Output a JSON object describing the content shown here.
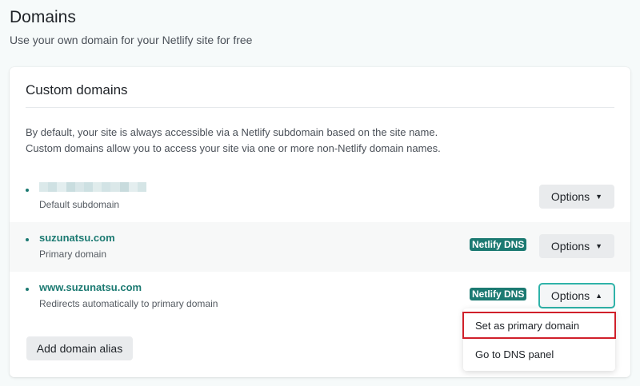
{
  "header": {
    "title": "Domains",
    "subtitle": "Use your own domain for your Netlify site for free"
  },
  "card": {
    "title": "Custom domains",
    "description": [
      "By default, your site is always accessible via a Netlify subdomain based on the site name.",
      "Custom domains allow you to access your site via one or more non-Netlify domain names."
    ],
    "domains": [
      {
        "name": "",
        "subtitle": "Default subdomain",
        "badge": null,
        "options_label": "Options",
        "chevron": "chevron-down-icon"
      },
      {
        "name": "suzunatsu.com",
        "subtitle": "Primary domain",
        "badge": "Netlify DNS",
        "options_label": "Options",
        "chevron": "chevron-down-icon"
      },
      {
        "name": "www.suzunatsu.com",
        "subtitle": "Redirects automatically to primary domain",
        "badge": "Netlify DNS",
        "options_label": "Options",
        "chevron": "chevron-up-icon"
      }
    ],
    "add_alias_label": "Add domain alias"
  },
  "dropdown": {
    "items": [
      {
        "label": "Set as primary domain",
        "selected": true
      },
      {
        "label": "Go to DNS panel",
        "selected": false
      }
    ]
  },
  "colors": {
    "accent": "#1c7a72",
    "focus_ring": "#2fb3a9",
    "highlight": "#d0202a",
    "background": "#f6fafa"
  }
}
